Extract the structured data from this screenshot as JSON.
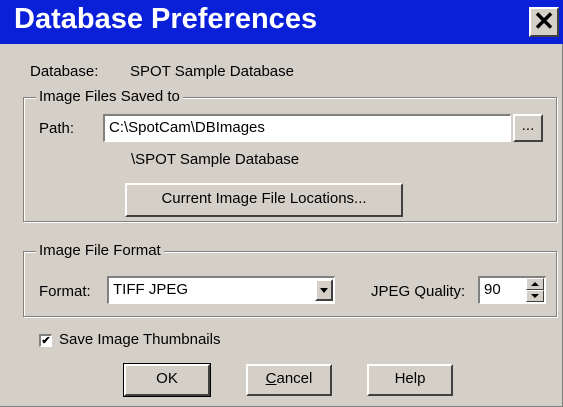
{
  "window": {
    "title": "Database Preferences",
    "close_icon": "close-icon"
  },
  "database": {
    "label": "Database:",
    "value": "SPOT Sample Database"
  },
  "image_files": {
    "group_label": "Image Files Saved to",
    "path_label": "Path:",
    "path_value": "C:\\SpotCam\\DBImages",
    "browse_label": "...",
    "subfolder": "\\SPOT Sample Database",
    "locations_button": "Current Image File Locations..."
  },
  "format": {
    "group_label": "Image File Format",
    "format_label": "Format:",
    "format_value": "TIFF JPEG",
    "quality_label": "JPEG Quality:",
    "quality_value": "90"
  },
  "thumbnails": {
    "label": "Save Image Thumbnails",
    "checked": true,
    "check_mark": "✔"
  },
  "buttons": {
    "ok": "OK",
    "cancel_mnemonic": "C",
    "cancel_rest": "ancel",
    "help": "Help"
  }
}
